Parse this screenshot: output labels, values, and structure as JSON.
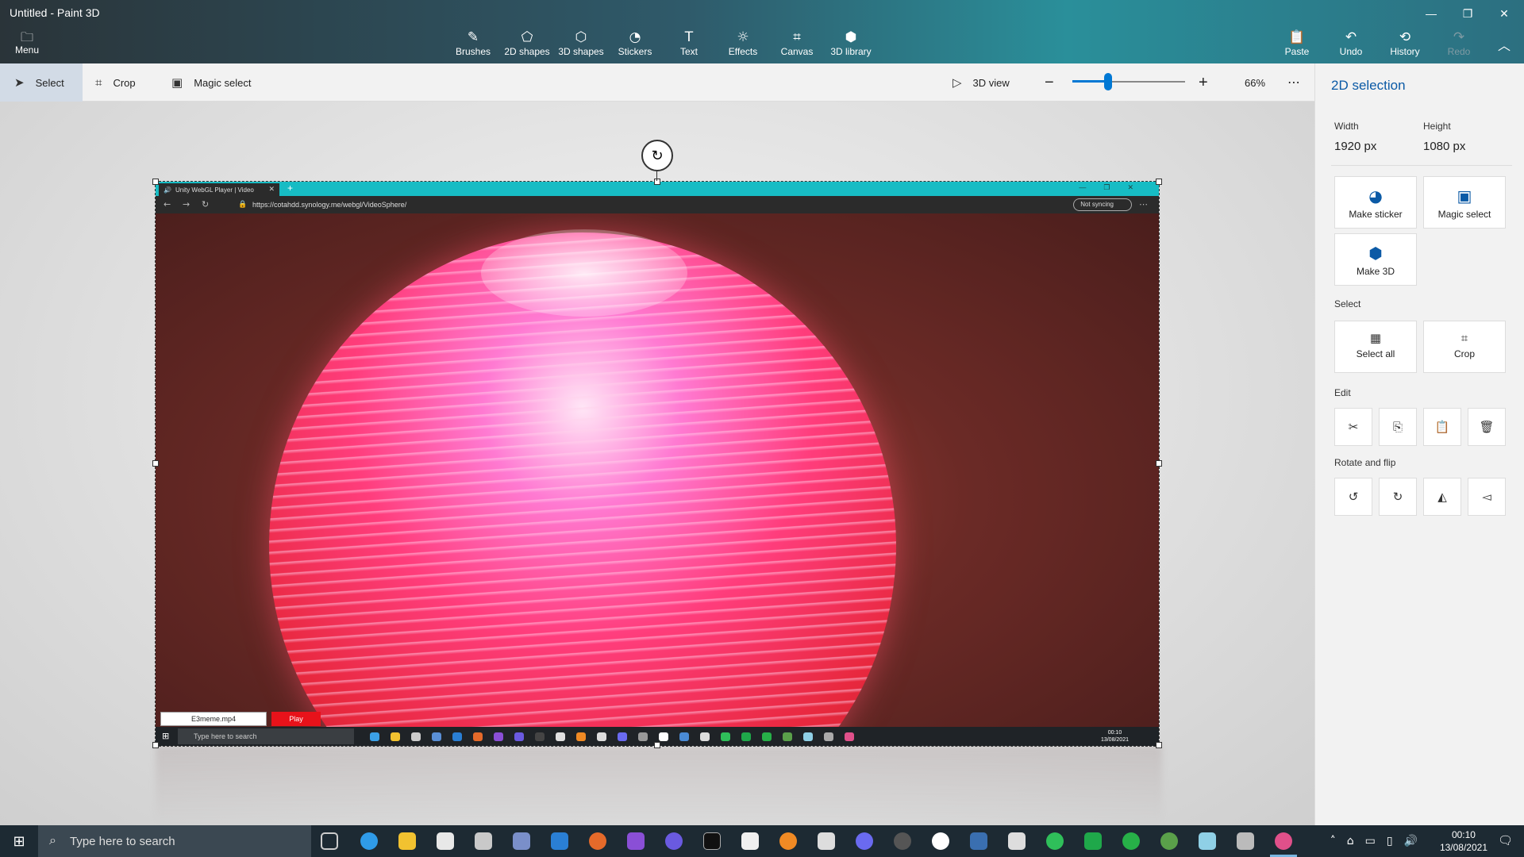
{
  "window": {
    "title": "Untitled - Paint 3D",
    "controls": {
      "minimize": "—",
      "restore": "❐",
      "close": "✕"
    }
  },
  "commandbar": {
    "menu": {
      "label": "Menu",
      "icon": "folder-icon"
    },
    "tools": [
      {
        "label": "Brushes",
        "icon": "brush-icon"
      },
      {
        "label": "2D shapes",
        "icon": "2d-shapes-icon"
      },
      {
        "label": "3D shapes",
        "icon": "3d-shapes-icon"
      },
      {
        "label": "Stickers",
        "icon": "sticker-icon"
      },
      {
        "label": "Text",
        "icon": "text-icon"
      },
      {
        "label": "Effects",
        "icon": "effects-icon"
      },
      {
        "label": "Canvas",
        "icon": "canvas-icon"
      },
      {
        "label": "3D library",
        "icon": "3d-library-icon"
      }
    ],
    "actions": [
      {
        "label": "Paste",
        "icon": "paste-icon"
      },
      {
        "label": "Undo",
        "icon": "undo-icon"
      },
      {
        "label": "History",
        "icon": "history-icon"
      },
      {
        "label": "Redo",
        "icon": "redo-icon",
        "disabled": true
      }
    ]
  },
  "toolbar": {
    "select": "Select",
    "crop": "Crop",
    "magic_select": "Magic select",
    "view_3d": "3D view",
    "zoom_value": "66%",
    "zoom_fraction": 0.33
  },
  "embedded_screenshot": {
    "tab_title": "Unity WebGL Player | Video",
    "url": "https://cotahdd.synology.me/webgl/VideoSphere/",
    "sync_label": "Not syncing",
    "file_field": "E3meme.mp4",
    "play_button": "Play",
    "search_placeholder": "Type here to search",
    "clock_time": "00:10",
    "clock_date": "13/08/2021"
  },
  "panel": {
    "title": "2D selection",
    "width_label": "Width",
    "width_value": "1920 px",
    "height_label": "Height",
    "height_value": "1080 px",
    "make_sticker": "Make sticker",
    "magic_select": "Magic select",
    "make_3d": "Make 3D",
    "select_heading": "Select",
    "select_all": "Select all",
    "crop": "Crop",
    "edit_heading": "Edit",
    "rotate_heading": "Rotate and flip"
  },
  "taskbar": {
    "search_placeholder": "Type here to search",
    "clock_time": "00:10",
    "clock_date": "13/08/2021",
    "accent": "#7ab6e0"
  },
  "colors": {
    "accent_blue": "#0078d4",
    "panel_title": "#0b5aa6",
    "play_red": "#e8121a",
    "browser_teal": "#17bcc4"
  }
}
